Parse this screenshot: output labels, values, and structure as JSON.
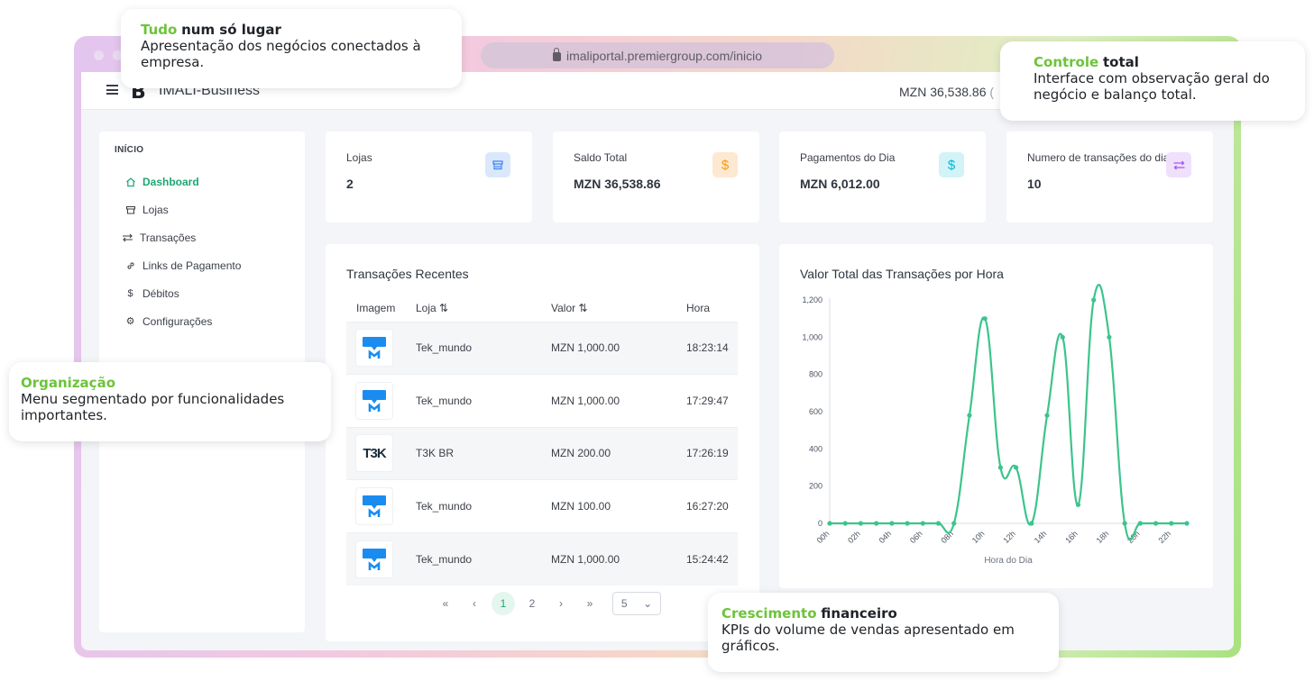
{
  "browser": {
    "url": "imaliportal.premiergroup.com/inicio"
  },
  "app": {
    "logo": "B",
    "brand": "IMALI-Business",
    "balance": "MZN 36,538.86",
    "balance_suffix": "("
  },
  "sidebar": {
    "section": "INÍCIO",
    "items": [
      {
        "label": "Dashboard",
        "icon": "home-icon"
      },
      {
        "label": "Lojas",
        "icon": "store-icon"
      },
      {
        "label": "Transações",
        "icon": "swap-icon"
      },
      {
        "label": "Links de Pagamento",
        "icon": "link-icon"
      },
      {
        "label": "Débitos",
        "icon": "dollar-icon"
      },
      {
        "label": "Configurações",
        "icon": "gear-icon"
      }
    ]
  },
  "kpis": [
    {
      "label": "Lojas",
      "value": "2",
      "icon": "store-icon",
      "color": "#3b82f6"
    },
    {
      "label": "Saldo Total",
      "value": "MZN 36,538.86",
      "icon": "dollar-icon",
      "color": "#f59e0b"
    },
    {
      "label": "Pagamentos do Dia",
      "value": "MZN 6,012.00",
      "icon": "dollar-icon",
      "color": "#06b6d4"
    },
    {
      "label": "Numero de transações do dia",
      "value": "10",
      "icon": "swap-icon",
      "color": "#a855f7"
    }
  ],
  "transactions": {
    "title": "Transações Recentes",
    "columns": {
      "image": "Imagem",
      "store": "Loja",
      "value": "Valor",
      "time": "Hora"
    },
    "rows": [
      {
        "store": "Tek_mundo",
        "value": "MZN 1,000.00",
        "time": "18:23:14",
        "logo": "tek"
      },
      {
        "store": "Tek_mundo",
        "value": "MZN 1,000.00",
        "time": "17:29:47",
        "logo": "tek"
      },
      {
        "store": "T3K BR",
        "value": "MZN 200.00",
        "time": "17:26:19",
        "logo": "t3k"
      },
      {
        "store": "Tek_mundo",
        "value": "MZN 100.00",
        "time": "16:27:20",
        "logo": "tek"
      },
      {
        "store": "Tek_mundo",
        "value": "MZN 1,000.00",
        "time": "15:24:42",
        "logo": "tek"
      }
    ],
    "t3k_logo_text": "T3K",
    "pager": {
      "first": "«",
      "prev": "‹",
      "pages": [
        "1",
        "2"
      ],
      "next": "›",
      "last": "»",
      "per_page": "5"
    }
  },
  "chart_data": {
    "type": "line",
    "title": "Valor Total das Transações por Hora",
    "xlabel": "Hora do Dia",
    "ylabel": "",
    "x": [
      "00h",
      "01h",
      "02h",
      "03h",
      "04h",
      "05h",
      "06h",
      "07h",
      "08h",
      "09h",
      "10h",
      "11h",
      "12h",
      "13h",
      "14h",
      "15h",
      "16h",
      "17h",
      "18h",
      "19h",
      "20h",
      "21h",
      "22h",
      "23h"
    ],
    "x_tick_labels": [
      "00h",
      "02h",
      "04h",
      "06h",
      "08h",
      "10h",
      "12h",
      "14h",
      "16h",
      "18h",
      "20h",
      "22h"
    ],
    "values": [
      0,
      0,
      0,
      0,
      0,
      0,
      0,
      0,
      0,
      580,
      1100,
      300,
      300,
      0,
      580,
      1000,
      100,
      1200,
      1000,
      0,
      0,
      0,
      0,
      0
    ],
    "ylim": [
      0,
      1200
    ],
    "yticks": [
      "0",
      "200",
      "400",
      "600",
      "800",
      "1,000",
      "1,200"
    ],
    "color": "#3cc48d",
    "grid": false
  },
  "callouts": {
    "tudo": {
      "accent": "Tudo",
      "bold": "num só lugar",
      "text": "Apresentação dos negócios conectados à empresa."
    },
    "controle": {
      "accent": "Controle",
      "bold": "total",
      "text": "Interface com observação geral do negócio e balanço total."
    },
    "organizacao": {
      "accent": "Organização",
      "bold": "",
      "text": "Menu segmentado por funcionalidades importantes."
    },
    "crescimento": {
      "accent": "Crescimento",
      "bold": "financeiro",
      "text": "KPIs do volume de vendas apresentado em gráficos."
    }
  }
}
